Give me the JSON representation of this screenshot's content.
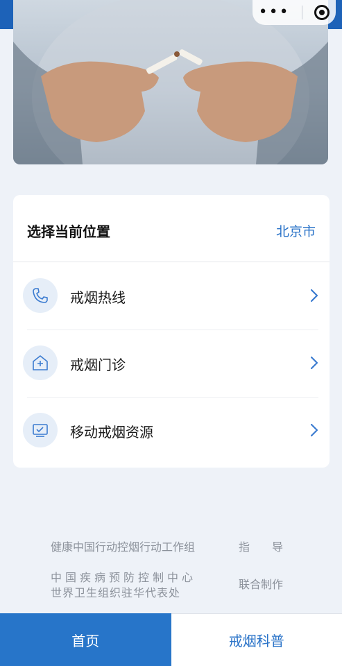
{
  "card": {
    "title": "选择当前位置",
    "city": "北京市",
    "items": [
      {
        "label": "戒烟热线",
        "icon": "phone-icon"
      },
      {
        "label": "戒烟门诊",
        "icon": "clinic-icon"
      },
      {
        "label": "移动戒烟资源",
        "icon": "computer-icon"
      }
    ]
  },
  "footer": {
    "guide_org": "健康中国行动控烟行动工作组",
    "guide_role": "指　　导",
    "producer_1": "中国疾病预防控制中心",
    "producer_2": "世界卫生组织驻华代表处",
    "producer_role": "联合制作"
  },
  "tabs": [
    {
      "label": "首页",
      "active": true
    },
    {
      "label": "戒烟科普",
      "active": false
    }
  ],
  "colors": {
    "accent": "#2775c9",
    "topbar": "#1d62b8",
    "link": "#2a73c8"
  }
}
